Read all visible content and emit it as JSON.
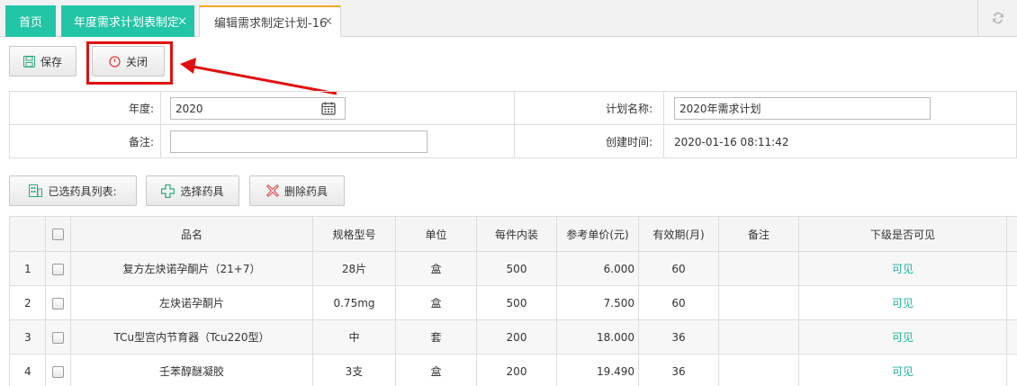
{
  "tabs": {
    "home": "首页",
    "plan": "年度需求计划表制定",
    "edit": "编辑需求制定计划-16",
    "close_glyph": "×"
  },
  "toolbar": {
    "save_label": "保存",
    "close_label": "关闭"
  },
  "form": {
    "year_label": "年度:",
    "year_value": "2020",
    "plan_name_label": "计划名称:",
    "plan_name_value": "2020年需求计划",
    "remark_label": "备注:",
    "remark_value": "",
    "created_label": "创建时间:",
    "created_value": "2020-01-16 08:11:42"
  },
  "list_toolbar": {
    "selected_label": "已选药具列表:",
    "select_label": "选择药具",
    "delete_label": "删除药具"
  },
  "table": {
    "headers": [
      "品名",
      "规格型号",
      "单位",
      "每件内装",
      "参考单价(元)",
      "有效期(月)",
      "备注",
      "下级是否可见"
    ],
    "rows": [
      {
        "no": "1",
        "name": "复方左炔诺孕酮片（21+7）",
        "spec": "28片",
        "unit": "盒",
        "per_pack": "500",
        "price": "6.000",
        "validity": "60",
        "remark": "",
        "visible": "可见"
      },
      {
        "no": "2",
        "name": "左炔诺孕酮片",
        "spec": "0.75mg",
        "unit": "盒",
        "per_pack": "500",
        "price": "7.500",
        "validity": "60",
        "remark": "",
        "visible": "可见"
      },
      {
        "no": "3",
        "name": "TCu型宫内节育器（Tcu220型）",
        "spec": "中",
        "unit": "套",
        "per_pack": "200",
        "price": "18.000",
        "validity": "36",
        "remark": "",
        "visible": "可见"
      },
      {
        "no": "4",
        "name": "壬苯醇醚凝胶",
        "spec": "3支",
        "unit": "盒",
        "per_pack": "200",
        "price": "19.490",
        "validity": "36",
        "remark": "",
        "visible": "可见"
      }
    ]
  },
  "colors": {
    "tab_green": "#22c5a6",
    "active_tab_accent": "#f5a623",
    "annotation_red": "#e01010",
    "visible_text": "#1fb39a"
  },
  "icons": [
    "save-icon",
    "power-icon",
    "calendar-icon",
    "list-icon",
    "plus-icon",
    "delete-icon",
    "refresh-icon",
    "close-icon"
  ]
}
